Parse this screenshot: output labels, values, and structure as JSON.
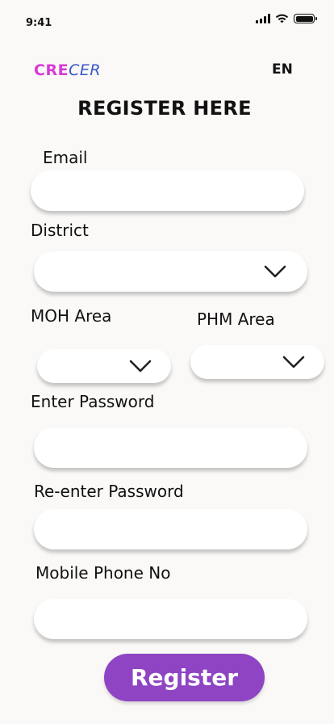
{
  "status": {
    "time": "9:41"
  },
  "header": {
    "logo_part1": "CRE",
    "logo_part2": "CER",
    "language": "EN"
  },
  "page_title": "REGISTER HERE",
  "form": {
    "email_label": "Email",
    "email_value": "",
    "district_label": "District",
    "district_value": "",
    "moh_label": "MOH Area",
    "moh_value": "",
    "phm_label": "PHM Area",
    "phm_value": "",
    "password_label": "Enter Password",
    "password_value": "",
    "reenter_label": "Re-enter Password",
    "reenter_value": "",
    "mobile_label": "Mobile Phone No",
    "mobile_value": ""
  },
  "register_button": "Register",
  "icons": {
    "dropdown": "chevron-down-icon"
  },
  "colors": {
    "accent": "#8e44c3",
    "logo_pink": "#d83bd6",
    "logo_blue": "#3a56c8",
    "background": "#faf9f7"
  }
}
